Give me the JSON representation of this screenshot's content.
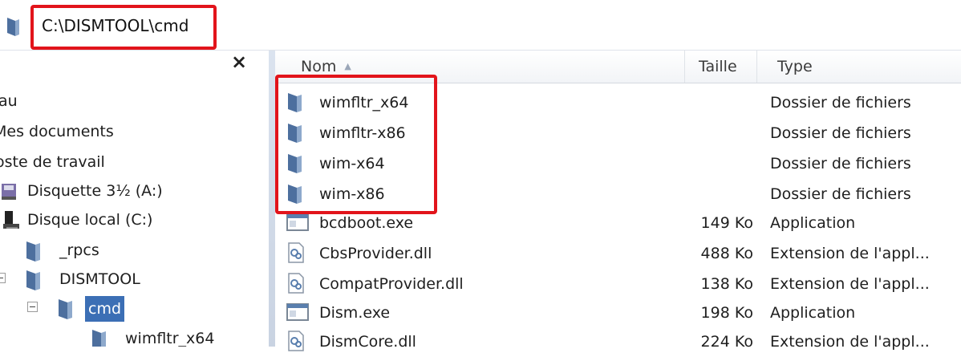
{
  "address_bar": {
    "path": "C:\\DISMTOOL\\cmd"
  },
  "tree": {
    "close_glyph": "×",
    "items": [
      {
        "label": "au"
      },
      {
        "label": "Mes documents"
      },
      {
        "label": "oste de travail"
      },
      {
        "label": "Disquette 3½ (A:)"
      },
      {
        "label": "Disque local (C:)"
      },
      {
        "label": "_rpcs"
      },
      {
        "label": "DISMTOOL"
      },
      {
        "label": "cmd"
      },
      {
        "label": "wimfltr_x64"
      }
    ]
  },
  "list": {
    "columns": {
      "name": "Nom",
      "size": "Taille",
      "type": "Type"
    },
    "rows": [
      {
        "name": "wimfltr_x64",
        "size": "",
        "type": "Dossier de fichiers",
        "icon": "folder-icon"
      },
      {
        "name": "wimfltr-x86",
        "size": "",
        "type": "Dossier de fichiers",
        "icon": "folder-icon"
      },
      {
        "name": "wim-x64",
        "size": "",
        "type": "Dossier de fichiers",
        "icon": "folder-icon"
      },
      {
        "name": "wim-x86",
        "size": "",
        "type": "Dossier de fichiers",
        "icon": "folder-icon"
      },
      {
        "name": "bcdboot.exe",
        "size": "149 Ko",
        "type": "Application",
        "icon": "exe-icon"
      },
      {
        "name": "CbsProvider.dll",
        "size": "488 Ko",
        "type": "Extension de l'appl...",
        "icon": "dll-icon"
      },
      {
        "name": "CompatProvider.dll",
        "size": "138 Ko",
        "type": "Extension de l'appl...",
        "icon": "dll-icon"
      },
      {
        "name": "Dism.exe",
        "size": "198 Ko",
        "type": "Application",
        "icon": "exe-icon"
      },
      {
        "name": "DismCore.dll",
        "size": "224 Ko",
        "type": "Extension de l'appl...",
        "icon": "dll-icon"
      }
    ]
  },
  "colors": {
    "highlight_box": "#e2141b",
    "selection": "#3c6fb5",
    "folder": "#5a7fae"
  }
}
